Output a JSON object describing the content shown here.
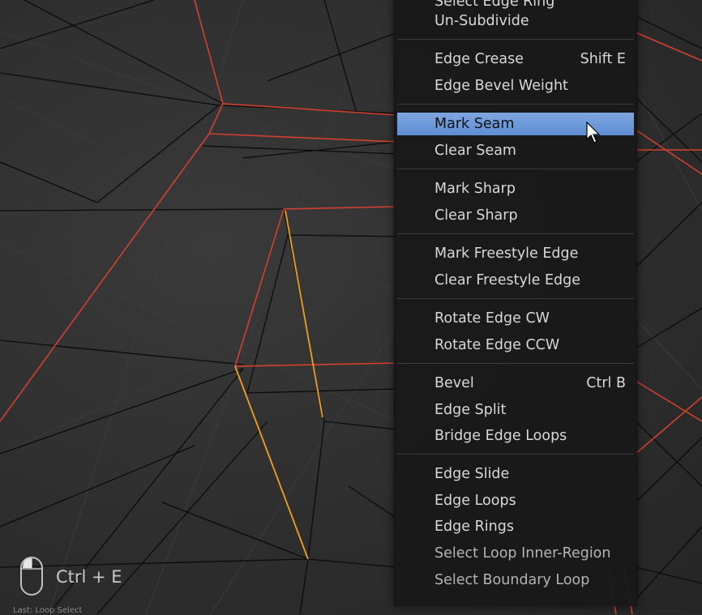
{
  "menu": {
    "top_partial_label": "Select Edge Ring",
    "items": [
      {
        "label": "Un-Subdivide",
        "shortcut": ""
      },
      {
        "label": "Edge Crease",
        "shortcut": "Shift E"
      },
      {
        "label": "Edge Bevel Weight",
        "shortcut": ""
      },
      {
        "label": "Mark Seam",
        "shortcut": "",
        "state": "highlighted"
      },
      {
        "label": "Clear Seam",
        "shortcut": ""
      },
      {
        "label": "Mark Sharp",
        "shortcut": ""
      },
      {
        "label": "Clear Sharp",
        "shortcut": ""
      },
      {
        "label": "Mark Freestyle Edge",
        "shortcut": ""
      },
      {
        "label": "Clear Freestyle Edge",
        "shortcut": ""
      },
      {
        "label": "Rotate Edge CW",
        "shortcut": ""
      },
      {
        "label": "Rotate Edge CCW",
        "shortcut": ""
      },
      {
        "label": "Bevel",
        "shortcut": "Ctrl B"
      },
      {
        "label": "Edge Split",
        "shortcut": ""
      },
      {
        "label": "Bridge Edge Loops",
        "shortcut": ""
      },
      {
        "label": "Edge Slide",
        "shortcut": ""
      },
      {
        "label": "Edge Loops",
        "shortcut": ""
      },
      {
        "label": "Edge Rings",
        "shortcut": ""
      },
      {
        "label": "Select Loop Inner-Region",
        "shortcut": ""
      },
      {
        "label": "Select Boundary Loop",
        "shortcut": ""
      }
    ],
    "highlight_color": "#6f9ad9"
  },
  "keystroke": {
    "label": "Ctrl + E",
    "icon": "mouse-icon"
  },
  "status": {
    "last_operator": "Last: Loop Select"
  },
  "colors": {
    "seam_edge": "#d2402f",
    "selected_edge": "#f0a020",
    "wire": "#0a0a0a"
  }
}
